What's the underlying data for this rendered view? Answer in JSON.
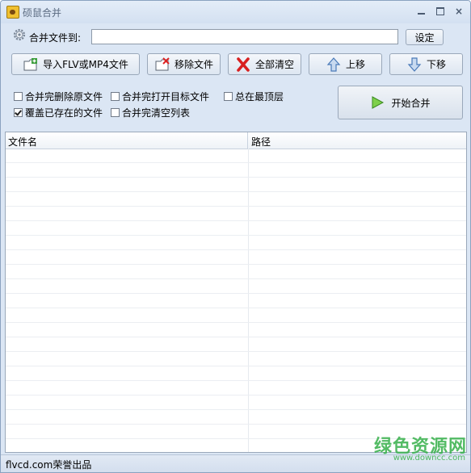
{
  "window": {
    "title": "硕鼠合并"
  },
  "merge": {
    "label": "合并文件到:",
    "value": "",
    "placeholder": "",
    "set_label": "设定"
  },
  "toolbar": {
    "import_label": "导入FLV或MP4文件",
    "remove_label": "移除文件",
    "clear_label": "全部清空",
    "up_label": "上移",
    "down_label": "下移"
  },
  "options": {
    "delete_source": {
      "label": "合并完删除原文件",
      "checked": false
    },
    "open_target": {
      "label": "合并完打开目标文件",
      "checked": false
    },
    "always_top": {
      "label": "总在最顶层",
      "checked": false
    },
    "overwrite": {
      "label": "覆盖已存在的文件",
      "checked": true
    },
    "clear_list": {
      "label": "合并完清空列表",
      "checked": false
    }
  },
  "start": {
    "label": "开始合并"
  },
  "list": {
    "columns": [
      "文件名",
      "路径"
    ],
    "rows": []
  },
  "status": {
    "text": "flvcd.com荣誉出品"
  },
  "watermark": {
    "cn": "绿色资源网",
    "url": "www.downcc.com"
  },
  "colors": {
    "accent": "#36b04a",
    "window_bg": "#dbe6f4"
  }
}
